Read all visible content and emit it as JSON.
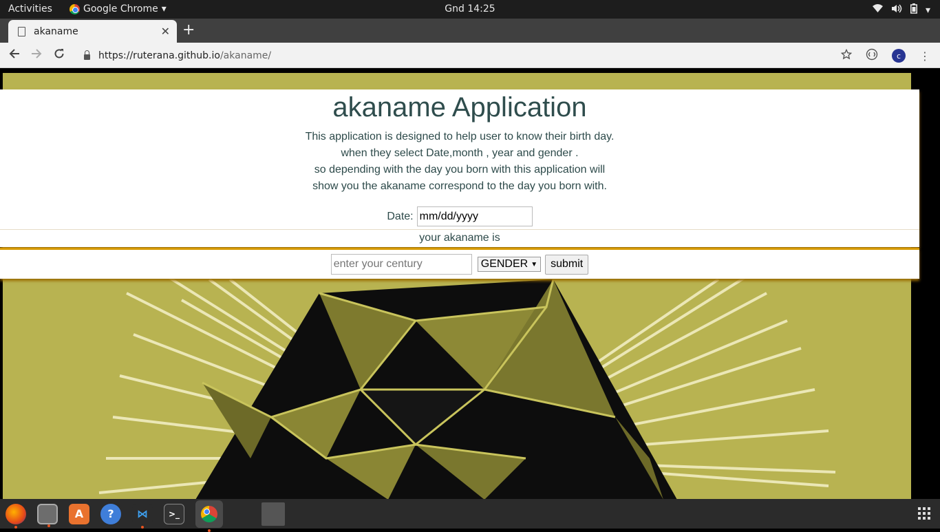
{
  "topbar": {
    "activities": "Activities",
    "app_name": "Google Chrome",
    "clock": "Gnd 14:25"
  },
  "browser": {
    "tab_title": "akaname",
    "url_domain": "https://ruterana.github.io",
    "url_path": "/akaname/",
    "avatar_letter": "c"
  },
  "page": {
    "heading": "akaname Application",
    "description_lines": [
      "This application is designed to help user to know their birth day.",
      "when they select Date,month , year and gender .",
      "so depending with the day you born with this application will",
      "show you the akaname correspond to the day you born with."
    ],
    "date_label": "Date:",
    "date_value": "mm/dd/yyyy",
    "result_text": "your akaname is",
    "century_placeholder": "enter your century",
    "gender_selected": "GENDER",
    "submit_label": "submit"
  },
  "colors": {
    "background_olive": "#b8b351",
    "heading_text": "#2f4d4d",
    "card_shadow": "#9a6b00"
  },
  "dock": {
    "items": [
      "firefox-icon",
      "files-icon",
      "software-icon",
      "help-icon",
      "vscode-icon",
      "terminal-icon",
      "chrome-icon",
      "window-icon"
    ]
  }
}
